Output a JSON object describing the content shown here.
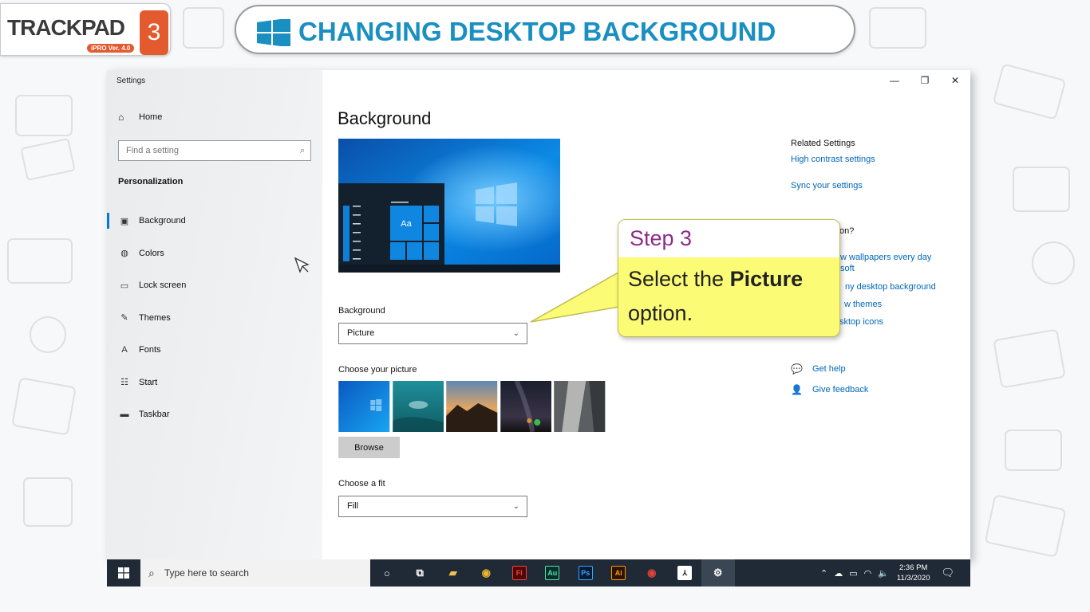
{
  "brand": {
    "name": "TRACKPAD",
    "version": "iPRO Ver. 4.0",
    "number": "3"
  },
  "banner": {
    "title": "CHANGING DESKTOP BACKGROUND"
  },
  "window": {
    "title": "Settings",
    "controls": {
      "minimize": "—",
      "restore": "❐",
      "close": "✕"
    }
  },
  "sidebar": {
    "home": "Home",
    "search_placeholder": "Find a setting",
    "section": "Personalization",
    "items": [
      {
        "label": "Background",
        "icon": "image-icon",
        "glyph": "▣"
      },
      {
        "label": "Colors",
        "icon": "palette-icon",
        "glyph": "◍"
      },
      {
        "label": "Lock screen",
        "icon": "lock-screen-icon",
        "glyph": "▭"
      },
      {
        "label": "Themes",
        "icon": "themes-icon",
        "glyph": "✎"
      },
      {
        "label": "Fonts",
        "icon": "fonts-icon",
        "glyph": "A"
      },
      {
        "label": "Start",
        "icon": "start-icon",
        "glyph": "☷"
      },
      {
        "label": "Taskbar",
        "icon": "taskbar-icon",
        "glyph": "▬"
      }
    ]
  },
  "main": {
    "title": "Background",
    "preview_tile_text": "Aa",
    "background_label": "Background",
    "background_value": "Picture",
    "choose_picture_label": "Choose your picture",
    "browse_label": "Browse",
    "fit_label": "Choose a fit",
    "fit_value": "Fill"
  },
  "related": {
    "heading": "Related Settings",
    "links": [
      "High contrast settings",
      "Sync your settings"
    ]
  },
  "question": {
    "heading_partial": "stion?",
    "links": [
      "w wallpapers every day",
      "soft",
      "ny desktop background",
      "w themes",
      "sktop icons"
    ]
  },
  "help": {
    "get_help": "Get help",
    "give_feedback": "Give feedback"
  },
  "callout": {
    "heading": "Step 3",
    "text_before": "Select the",
    "text_bold": "Picture",
    "text_after": "option."
  },
  "taskbar": {
    "search_placeholder": "Type here to search",
    "apps": [
      {
        "name": "cortana",
        "glyph": "○"
      },
      {
        "name": "task-view",
        "glyph": "⧉"
      },
      {
        "name": "file-explorer",
        "glyph": "▰"
      },
      {
        "name": "chrome",
        "glyph": "◉"
      },
      {
        "name": "flash",
        "glyph": "Fl"
      },
      {
        "name": "audition",
        "glyph": "Au"
      },
      {
        "name": "photoshop",
        "glyph": "Ps"
      },
      {
        "name": "illustrator",
        "glyph": "Ai"
      },
      {
        "name": "chrome-profile",
        "glyph": "◉"
      },
      {
        "name": "acrobat",
        "glyph": "⅄"
      },
      {
        "name": "settings",
        "glyph": "⚙"
      }
    ],
    "time": "2:36 PM",
    "date": "11/3/2020"
  },
  "colors": {
    "accent": "#0078d4",
    "link": "#0067b8",
    "banner_text": "#1a8fc1",
    "callout_bg": "#fbfb76",
    "callout_heading": "#8b2c8b",
    "taskbar": "#1f2a36"
  }
}
